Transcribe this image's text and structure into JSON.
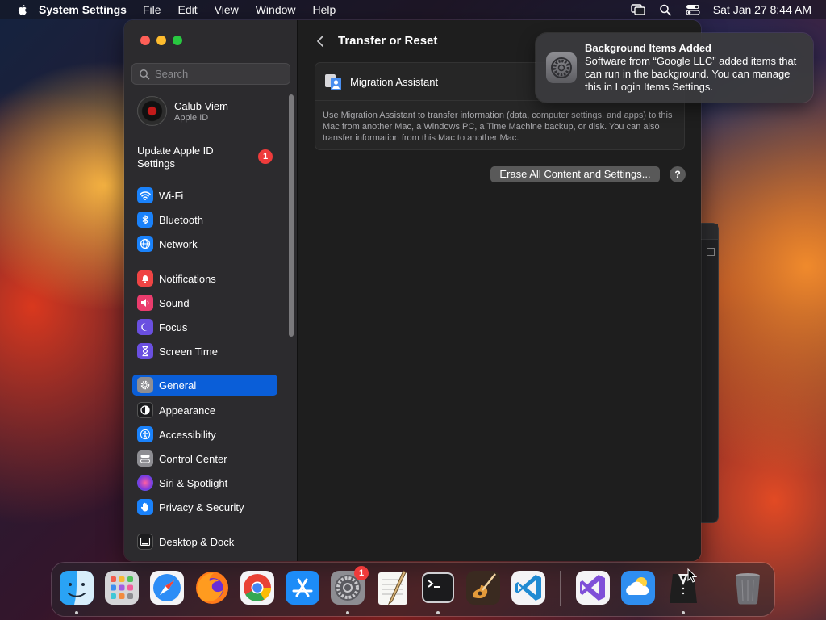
{
  "menubar": {
    "app_name": "System Settings",
    "menus": [
      "File",
      "Edit",
      "View",
      "Window",
      "Help"
    ],
    "clock": "Sat Jan 27  8:44 AM"
  },
  "sidebar": {
    "search_placeholder": "Search",
    "profile": {
      "name": "Calub Viem",
      "subtitle": "Apple ID"
    },
    "update": {
      "label": "Update Apple ID Settings",
      "badge": "1"
    },
    "items": [
      {
        "label": "Wi-Fi",
        "icon": "wifi-icon",
        "color": "#1a82fb"
      },
      {
        "label": "Bluetooth",
        "icon": "bluetooth-icon",
        "color": "#1a82fb"
      },
      {
        "label": "Network",
        "icon": "globe-icon",
        "color": "#1a82fb"
      },
      {
        "label": "Notifications",
        "icon": "bell-icon",
        "color": "#ef4444"
      },
      {
        "label": "Sound",
        "icon": "speaker-icon",
        "color": "#ea3c6d"
      },
      {
        "label": "Focus",
        "icon": "moon-icon",
        "color": "#6a4fe0"
      },
      {
        "label": "Screen Time",
        "icon": "hourglass-icon",
        "color": "#6a4fe0"
      },
      {
        "label": "General",
        "icon": "gear-icon",
        "color": "#8e8e93",
        "selected": true
      },
      {
        "label": "Appearance",
        "icon": "appearance-icon",
        "color": "#1c1c1e"
      },
      {
        "label": "Accessibility",
        "icon": "accessibility-icon",
        "color": "#1a82fb"
      },
      {
        "label": "Control Center",
        "icon": "control-center-icon",
        "color": "#8e8e93"
      },
      {
        "label": "Siri & Spotlight",
        "icon": "siri-icon",
        "color": "#b03ad6"
      },
      {
        "label": "Privacy & Security",
        "icon": "hand-icon",
        "color": "#1a82fb"
      },
      {
        "label": "Desktop & Dock",
        "icon": "dock-icon",
        "color": "#1c1c1e"
      }
    ]
  },
  "main": {
    "title": "Transfer or Reset",
    "migration_label": "Migration Assistant",
    "migration_description": "Use Migration Assistant to transfer information (data, computer settings, and apps) to this Mac from another Mac, a Windows PC, a Time Machine backup, or disk. You can also transfer information from this Mac to another Mac.",
    "erase_button": "Erase All Content and Settings...",
    "help_button": "?"
  },
  "notification": {
    "title": "Background Items Added",
    "body": "Software from “Google LLC” added items that can run in the background. You can manage this in Login Items Settings."
  },
  "dock": {
    "system_settings_badge": "1",
    "apps": [
      "finder-icon",
      "launchpad-icon",
      "safari-icon",
      "firefox-icon",
      "chrome-icon",
      "app-store-icon",
      "system-settings-icon",
      "textedit-icon",
      "terminal-icon",
      "garageband-icon",
      "vscode-icon",
      "visual-studio-icon",
      "weather-icon",
      "tuxedo-icon",
      "trash-icon"
    ]
  }
}
